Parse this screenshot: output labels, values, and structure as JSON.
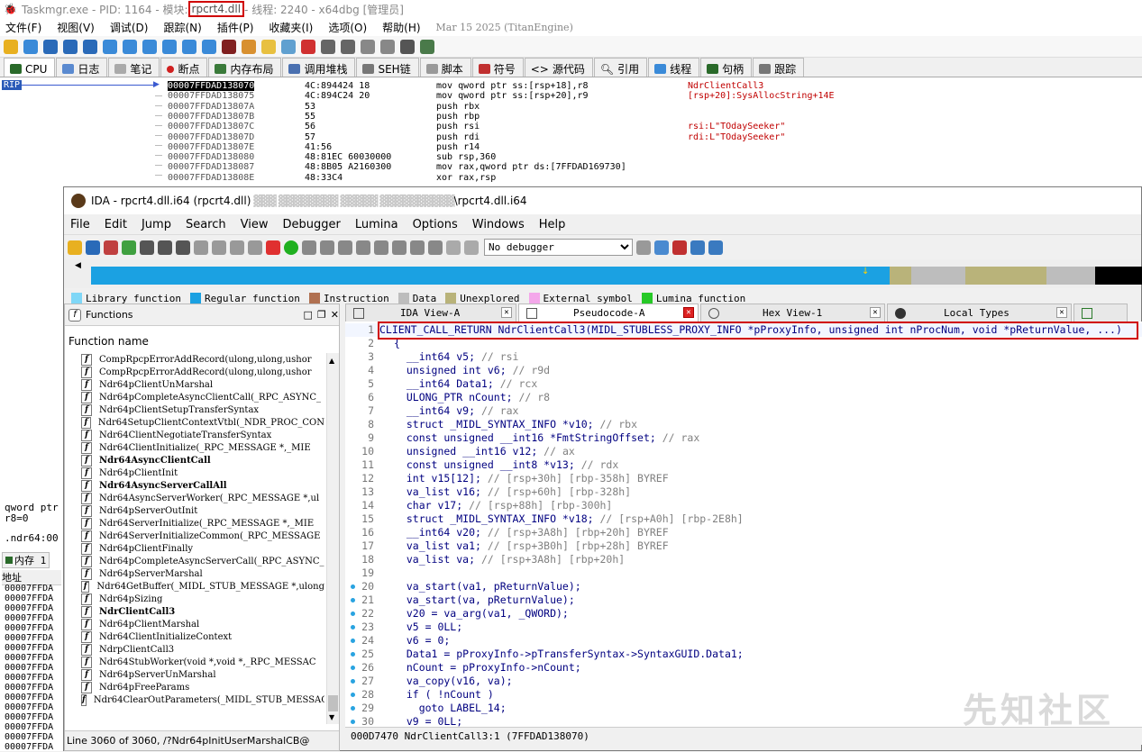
{
  "x64dbg": {
    "title_pre": "Taskmgr.exe - PID: 1164 - 模块: ",
    "title_module": "rpcrt4.dll",
    "title_post": " - 线程: 2240 - x64dbg [管理员]",
    "menu": [
      "文件(F)",
      "视图(V)",
      "调试(D)",
      "跟踪(N)",
      "插件(P)",
      "收藏夹(I)",
      "选项(O)",
      "帮助(H)"
    ],
    "menu_date": "Mar 15 2025 (TitanEngine)",
    "tabs": [
      "CPU",
      "日志",
      "笔记",
      "断点",
      "内存布局",
      "调用堆栈",
      "SEH链",
      "脚本",
      "符号",
      "源代码",
      "引用",
      "线程",
      "句柄",
      "跟踪"
    ],
    "rip": "RIP",
    "disasm": [
      {
        "addr": "00007FFDAD138070",
        "bytes": "4C:894424 18",
        "instr": "mov qword ptr ss:[rsp+18],r8",
        "comment": "NdrClientCall3"
      },
      {
        "addr": "00007FFDAD138075",
        "bytes": "4C:894C24 20",
        "instr": "mov qword ptr ss:[rsp+20],r9",
        "comment": "[rsp+20]:SysAllocString+14E"
      },
      {
        "addr": "00007FFDAD13807A",
        "bytes": "53",
        "instr": "push rbx",
        "comment": ""
      },
      {
        "addr": "00007FFDAD13807B",
        "bytes": "55",
        "instr": "push rbp",
        "comment": ""
      },
      {
        "addr": "00007FFDAD13807C",
        "bytes": "56",
        "instr": "push rsi",
        "comment": "rsi:L\"TOdaySeeker\""
      },
      {
        "addr": "00007FFDAD13807D",
        "bytes": "57",
        "instr": "push rdi",
        "comment": "rdi:L\"TOdaySeeker\""
      },
      {
        "addr": "00007FFDAD13807E",
        "bytes": "41:56",
        "instr": "push r14",
        "comment": ""
      },
      {
        "addr": "00007FFDAD138080",
        "bytes": "48:81EC 60030000",
        "instr": "sub rsp,360",
        "comment": ""
      },
      {
        "addr": "00007FFDAD138087",
        "bytes": "48:8B05 A2160300",
        "instr": "mov rax,qword ptr ds:[7FFDAD169730]",
        "comment": ""
      },
      {
        "addr": "00007FFDAD13808E",
        "bytes": "48:33C4",
        "instr": "xor rax,rsp",
        "comment": ""
      }
    ],
    "left_pane": {
      "line1": "qword ptr",
      "line2": "r8=0",
      "line3": ".ndr64:00",
      "tab": "内存 1",
      "addr_hdr": "地址",
      "addr_item": "00007FFDA"
    }
  },
  "ida": {
    "title_pre": "IDA - rpcrt4.dll.i64 (rpcrt4.dll)",
    "title_path": "\\rpcrt4.dll.i64",
    "menu": [
      "File",
      "Edit",
      "Jump",
      "Search",
      "View",
      "Debugger",
      "Lumina",
      "Options",
      "Windows",
      "Help"
    ],
    "debugger_select": "No debugger",
    "legend": [
      {
        "label": "Library function",
        "color": "#7fd7f7"
      },
      {
        "label": "Regular function",
        "color": "#1ba1e2"
      },
      {
        "label": "Instruction",
        "color": "#b07050"
      },
      {
        "label": "Data",
        "color": "#bdbdbd"
      },
      {
        "label": "Unexplored",
        "color": "#b9b37a"
      },
      {
        "label": "External symbol",
        "color": "#f4a7ea"
      },
      {
        "label": "Lumina function",
        "color": "#27c927"
      }
    ],
    "functions_title": "Functions",
    "function_col": "Function name",
    "functions": [
      {
        "name": "CompRpcpErrorAddRecord(ulong,ulong,ushor",
        "bold": false
      },
      {
        "name": "CompRpcpErrorAddRecord(ulong,ulong,ushor",
        "bold": false
      },
      {
        "name": "Ndr64pClientUnMarshal",
        "bold": false
      },
      {
        "name": "Ndr64pCompleteAsyncClientCall(_RPC_ASYNC_",
        "bold": false
      },
      {
        "name": "Ndr64pClientSetupTransferSyntax",
        "bold": false
      },
      {
        "name": "Ndr64SetupClientContextVtbl(_NDR_PROC_CON",
        "bold": false
      },
      {
        "name": "Ndr64ClientNegotiateTransferSyntax",
        "bold": false
      },
      {
        "name": "Ndr64ClientInitialize(_RPC_MESSAGE *,_MIE",
        "bold": false
      },
      {
        "name": "Ndr64AsyncClientCall",
        "bold": true
      },
      {
        "name": "Ndr64pClientInit",
        "bold": false
      },
      {
        "name": "Ndr64AsyncServerCallAll",
        "bold": true
      },
      {
        "name": "Ndr64AsyncServerWorker(_RPC_MESSAGE *,ul",
        "bold": false
      },
      {
        "name": "Ndr64pServerOutInit",
        "bold": false
      },
      {
        "name": "Ndr64ServerInitialize(_RPC_MESSAGE *,_MIE",
        "bold": false
      },
      {
        "name": "Ndr64ServerInitializeCommon(_RPC_MESSAGE",
        "bold": false
      },
      {
        "name": "Ndr64pClientFinally",
        "bold": false
      },
      {
        "name": "Ndr64pCompleteAsyncServerCall(_RPC_ASYNC_",
        "bold": false
      },
      {
        "name": "Ndr64pServerMarshal",
        "bold": false
      },
      {
        "name": "Ndr64GetBuffer(_MIDL_STUB_MESSAGE *,ulong",
        "bold": false
      },
      {
        "name": "Ndr64pSizing",
        "bold": false
      },
      {
        "name": "NdrClientCall3",
        "bold": true
      },
      {
        "name": "Ndr64pClientMarshal",
        "bold": false
      },
      {
        "name": "Ndr64ClientInitializeContext",
        "bold": false
      },
      {
        "name": "NdrpClientCall3",
        "bold": false
      },
      {
        "name": "Ndr64StubWorker(void *,void *,_RPC_MESSAC",
        "bold": false
      },
      {
        "name": "Ndr64pServerUnMarshal",
        "bold": false
      },
      {
        "name": "Ndr64pFreeParams",
        "bold": false
      },
      {
        "name": "Ndr64ClearOutParameters(_MIDL_STUB_MESSAC",
        "bold": false
      }
    ],
    "functions_status": "Line 3060 of 3060, /?Ndr64pInitUserMarshalCB@",
    "tabs": [
      {
        "label": "IDA View-A",
        "active": false
      },
      {
        "label": "Pseudocode-A",
        "active": true
      },
      {
        "label": "Hex View-1",
        "active": false
      },
      {
        "label": "Local Types",
        "active": false
      }
    ],
    "code": [
      {
        "n": "1",
        "t": "CLIENT_CALL_RETURN NdrClientCall3(MIDL_STUBLESS_PROXY_INFO *pProxyInfo, unsigned int nProcNum, void *pReturnValue, ...)",
        "c": "",
        "dot": false
      },
      {
        "n": "2",
        "t": "{",
        "c": "",
        "dot": false
      },
      {
        "n": "3",
        "t": "  __int64 v5; ",
        "c": "// rsi",
        "dot": false
      },
      {
        "n": "4",
        "t": "  unsigned int v6; ",
        "c": "// r9d",
        "dot": false
      },
      {
        "n": "5",
        "t": "  __int64 Data1; ",
        "c": "// rcx",
        "dot": false
      },
      {
        "n": "6",
        "t": "  ULONG_PTR nCount; ",
        "c": "// r8",
        "dot": false
      },
      {
        "n": "7",
        "t": "  __int64 v9; ",
        "c": "// rax",
        "dot": false
      },
      {
        "n": "8",
        "t": "  struct _MIDL_SYNTAX_INFO *v10; ",
        "c": "// rbx",
        "dot": false
      },
      {
        "n": "9",
        "t": "  const unsigned __int16 *FmtStringOffset; ",
        "c": "// rax",
        "dot": false
      },
      {
        "n": "10",
        "t": "  unsigned __int16 v12; ",
        "c": "// ax",
        "dot": false
      },
      {
        "n": "11",
        "t": "  const unsigned __int8 *v13; ",
        "c": "// rdx",
        "dot": false
      },
      {
        "n": "12",
        "t": "  int v15[12]; ",
        "c": "// [rsp+30h] [rbp-358h] BYREF",
        "dot": false
      },
      {
        "n": "13",
        "t": "  va_list v16; ",
        "c": "// [rsp+60h] [rbp-328h]",
        "dot": false
      },
      {
        "n": "14",
        "t": "  char v17; ",
        "c": "// [rsp+88h] [rbp-300h]",
        "dot": false
      },
      {
        "n": "15",
        "t": "  struct _MIDL_SYNTAX_INFO *v18; ",
        "c": "// [rsp+A0h] [rbp-2E8h]",
        "dot": false
      },
      {
        "n": "16",
        "t": "  __int64 v20; ",
        "c": "// [rsp+3A8h] [rbp+20h] BYREF",
        "dot": false
      },
      {
        "n": "17",
        "t": "  va_list va1; ",
        "c": "// [rsp+3B0h] [rbp+28h] BYREF",
        "dot": false
      },
      {
        "n": "18",
        "t": "  va_list va; ",
        "c": "// [rsp+3A8h] [rbp+20h]",
        "dot": false
      },
      {
        "n": "19",
        "t": "",
        "c": "",
        "dot": false
      },
      {
        "n": "20",
        "t": "  va_start(va1, pReturnValue);",
        "c": "",
        "dot": true
      },
      {
        "n": "21",
        "t": "  va_start(va, pReturnValue);",
        "c": "",
        "dot": true
      },
      {
        "n": "22",
        "t": "  v20 = va_arg(va1, _QWORD);",
        "c": "",
        "dot": true
      },
      {
        "n": "23",
        "t": "  v5 = 0LL;",
        "c": "",
        "dot": true
      },
      {
        "n": "24",
        "t": "  v6 = 0;",
        "c": "",
        "dot": true
      },
      {
        "n": "25",
        "t": "  Data1 = pProxyInfo->pTransferSyntax->SyntaxGUID.Data1;",
        "c": "",
        "dot": true
      },
      {
        "n": "26",
        "t": "  nCount = pProxyInfo->nCount;",
        "c": "",
        "dot": true
      },
      {
        "n": "27",
        "t": "  va_copy(v16, va);",
        "c": "",
        "dot": true
      },
      {
        "n": "28",
        "t": "  if ( !nCount )",
        "c": "",
        "dot": true
      },
      {
        "n": "29",
        "t": "    goto LABEL_14;",
        "c": "",
        "dot": true
      },
      {
        "n": "30",
        "t": "  v9 = 0LL;",
        "c": "",
        "dot": true
      }
    ],
    "code_status": "000D7470 NdrClientCall3:1 (7FFDAD138070)",
    "watermark": "先知社区"
  }
}
